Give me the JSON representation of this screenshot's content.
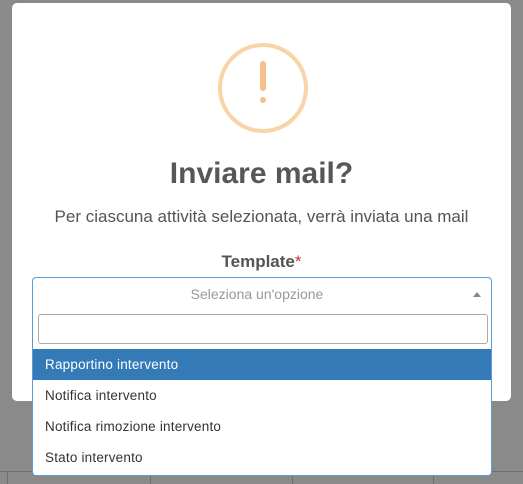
{
  "dialog": {
    "title": "Inviare mail?",
    "message": "Per ciascuna attività selezionata, verrà inviata una mail",
    "icon": "warning-icon",
    "icon_glyph": "!",
    "icon_color": "#f8bb86"
  },
  "field": {
    "label": "Template",
    "required_mark": "*"
  },
  "select": {
    "placeholder": "Seleziona un'opzione",
    "search_value": "",
    "options": [
      {
        "label": "Rapportino intervento",
        "highlighted": true
      },
      {
        "label": "Notifica intervento",
        "highlighted": false
      },
      {
        "label": "Notifica rimozione intervento",
        "highlighted": false
      },
      {
        "label": "Stato intervento",
        "highlighted": false
      }
    ],
    "highlight_color": "#337ab7",
    "border_color": "#5b9bd8"
  }
}
